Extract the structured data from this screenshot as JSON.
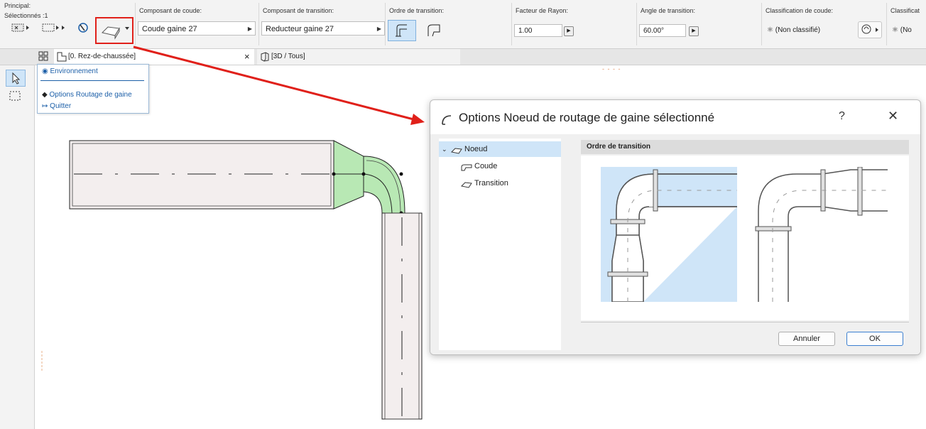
{
  "infobox": {
    "principal_label": "Principal:",
    "selected_label": "Sélectionnés :1",
    "elbow_component_label": "Composant de coude:",
    "elbow_component_value": "Coude gaine 27",
    "transition_component_label": "Composant de transition:",
    "transition_component_value": "Reducteur gaine 27",
    "transition_order_label": "Ordre de transition:",
    "radius_factor_label": "Facteur de Rayon:",
    "radius_factor_value": "1.00",
    "transition_angle_label": "Angle de transition:",
    "transition_angle_value": "60.00°",
    "elbow_classification_label": "Classification de coude:",
    "elbow_classification_value": "(Non classifié)",
    "classification2_label": "Classificat",
    "classification2_value": "(No"
  },
  "tabs": {
    "plan_tab": "[0. Rez-de-chaussée]",
    "close": "×",
    "view3d_tab": "[3D / Tous]",
    "canvas_marker": "- - - -"
  },
  "popup": {
    "environment": "Environnement",
    "routing_options": "Options Routage de gaine",
    "quit": "Quitter"
  },
  "dialog": {
    "title": "Options Noeud de routage de gaine sélectionné",
    "help": "?",
    "close": "✕",
    "tree": {
      "node": "Noeud",
      "elbow": "Coude",
      "transition": "Transition"
    },
    "section_header": "Ordre de transition",
    "cancel": "Annuler",
    "ok": "OK"
  },
  "colors": {
    "annotation_red": "#e0201a",
    "selection_blue": "#cfe5f8",
    "duct_green": "#b8e8b4",
    "duct_fill": "#f3eeee"
  }
}
